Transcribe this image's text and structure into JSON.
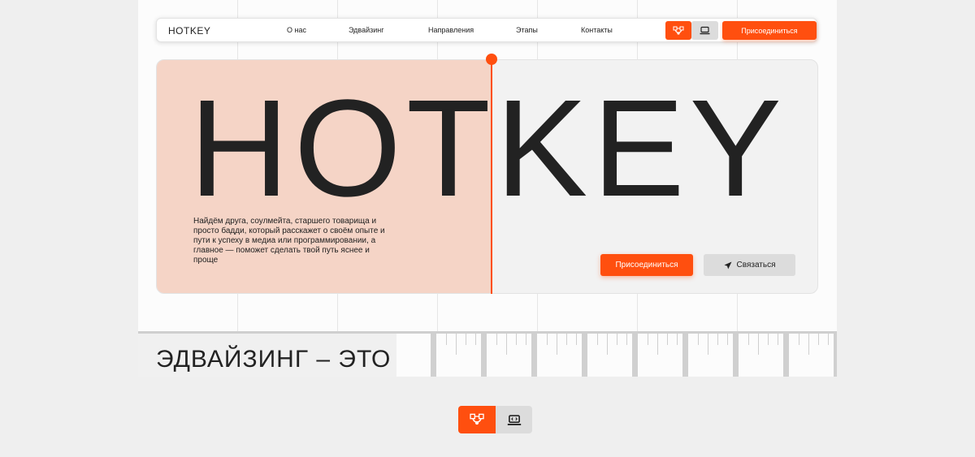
{
  "nav": {
    "logo": "HOTKEY",
    "links": [
      "О нас",
      "Эдвайзинг",
      "Направления",
      "Этапы",
      "Контакты"
    ],
    "join_label": "Присоединиться",
    "mode_icons": [
      "bezier-curve-icon",
      "laptop-code-icon"
    ]
  },
  "hero": {
    "title": "HOTKEY",
    "description": "Найдём друга, соулмейта, старшего товарища и просто бадди, который расскажет о своём опыте и пути к успеху в медиа или программировании, а главное — поможет сделать твой путь яснее и проще",
    "join_label": "Присоединиться",
    "contact_label": "Связаться",
    "contact_icon": "send-icon"
  },
  "ticker": {
    "text": "ЭДВАЙЗИНГ – ЭТО"
  },
  "switcher": {
    "icons": [
      "bezier-curve-icon",
      "laptop-code-icon"
    ]
  },
  "colors": {
    "accent": "#ff4f0f",
    "peach": "#f5d4c6",
    "panel": "#f2f2f2",
    "grey_button": "#dcdcdc",
    "page_bg": "#efefef"
  }
}
